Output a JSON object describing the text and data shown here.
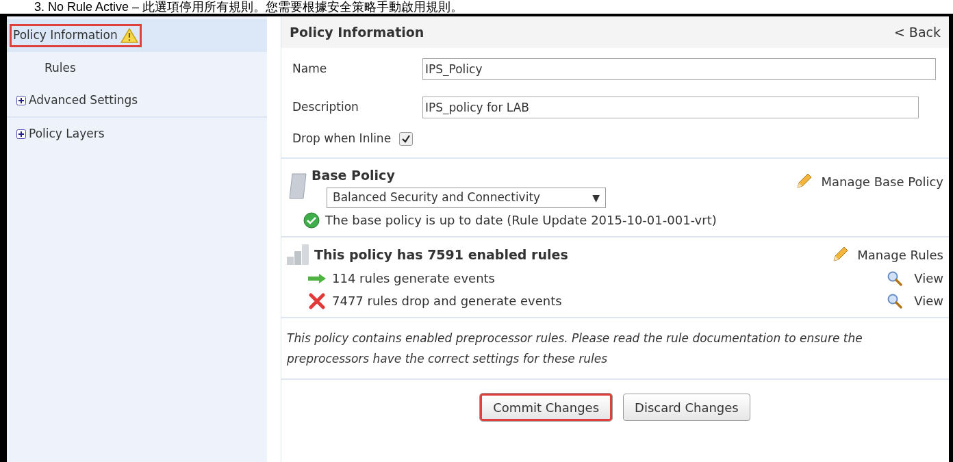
{
  "caption": "3. No Rule Active – 此選項停用所有規則。您需要根據安全策略手動啟用規則。",
  "sidebar": {
    "items": [
      {
        "label": "Policy Information",
        "selected": true,
        "warning": true,
        "highlighted": true,
        "expandable": false,
        "children": [
          {
            "label": "Rules",
            "selected": false,
            "warning": false,
            "highlighted": false,
            "expandable": false
          }
        ]
      },
      {
        "label": "Advanced Settings",
        "selected": false,
        "warning": false,
        "highlighted": false,
        "expandable": true
      },
      {
        "label": "Policy Layers",
        "selected": false,
        "warning": false,
        "highlighted": false,
        "expandable": true
      }
    ]
  },
  "panel": {
    "title": "Policy Information",
    "back": "< Back",
    "fields": [
      {
        "label": "Name",
        "value": "IPS_Policy"
      },
      {
        "label": "Description",
        "value": "IPS_policy for LAB"
      }
    ],
    "drop_when_inline": {
      "label": "Drop when Inline",
      "checked": true
    },
    "base_policy": {
      "title": "Base Policy",
      "select": "Balanced Security and Connectivity",
      "caret": "▼",
      "manage": "Manage Base Policy",
      "status": "The base policy is up to date (Rule Update 2015-10-01-001-vrt)"
    },
    "rules": {
      "title": "This policy has 7591 enabled rules",
      "manage": "Manage Rules",
      "lines": [
        {
          "kind": "generate",
          "text": "114 rules generate events",
          "view": "View"
        },
        {
          "kind": "drop",
          "text": "7477 rules drop and generate events",
          "view": "View"
        }
      ]
    },
    "note": "This policy contains enabled preprocessor rules. Please read the rule documentation to ensure the preprocessors have the correct settings for these rules",
    "buttons": [
      {
        "label": "Commit Changes",
        "highlighted": true
      },
      {
        "label": "Discard Changes",
        "highlighted": false
      }
    ]
  }
}
